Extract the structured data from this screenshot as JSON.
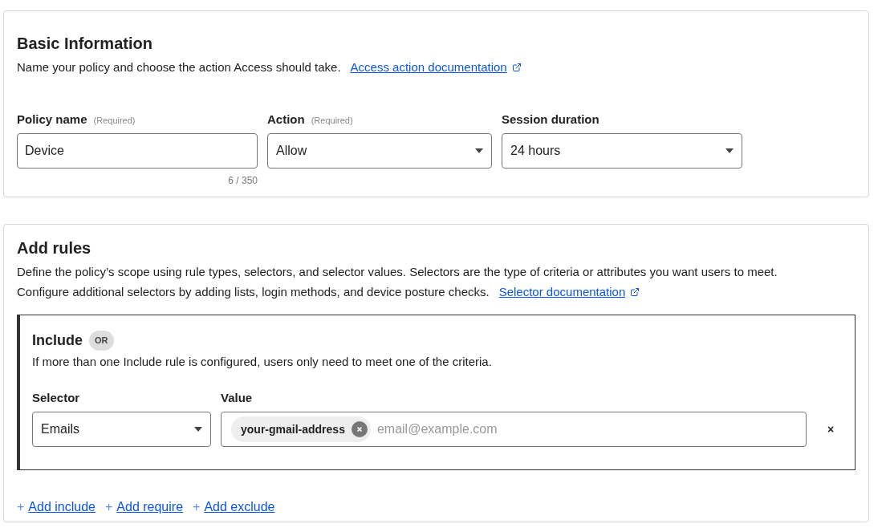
{
  "basic_information": {
    "title": "Basic Information",
    "description": "Name your policy and choose the action Access should take.",
    "doc_link": "Access action documentation",
    "fields": [
      {
        "kind": "text",
        "label": "Policy name",
        "hint": "(Required)",
        "value": "Device",
        "counter": "6 / 350"
      },
      {
        "kind": "select",
        "label": "Action",
        "hint": "(Required)",
        "value": "Allow"
      },
      {
        "kind": "select",
        "label": "Session duration",
        "value": "24 hours"
      }
    ]
  },
  "add_rules": {
    "title": "Add rules",
    "description_lines": [
      "Define the policy’s scope using rule types, selectors, and selector values. Selectors are the type of criteria or attributes you want users to meet.",
      "Configure additional selectors by adding lists, login methods, and device posture checks."
    ],
    "doc_link": "Selector documentation",
    "include": {
      "title": "Include",
      "badge": "OR",
      "description": "If more than one Include rule is configured, users only need to meet one of the criteria.",
      "rules": [
        {
          "selector_label": "Selector",
          "selector": "Emails",
          "value_label": "Value",
          "chips": [
            "your-gmail-address"
          ],
          "placeholder": "email@example.com",
          "remove": "×"
        }
      ]
    },
    "actions": [
      {
        "icon": "+",
        "label": "Add include"
      },
      {
        "icon": "+",
        "label": "Add require"
      },
      {
        "icon": "+",
        "label": "Add exclude"
      }
    ]
  }
}
